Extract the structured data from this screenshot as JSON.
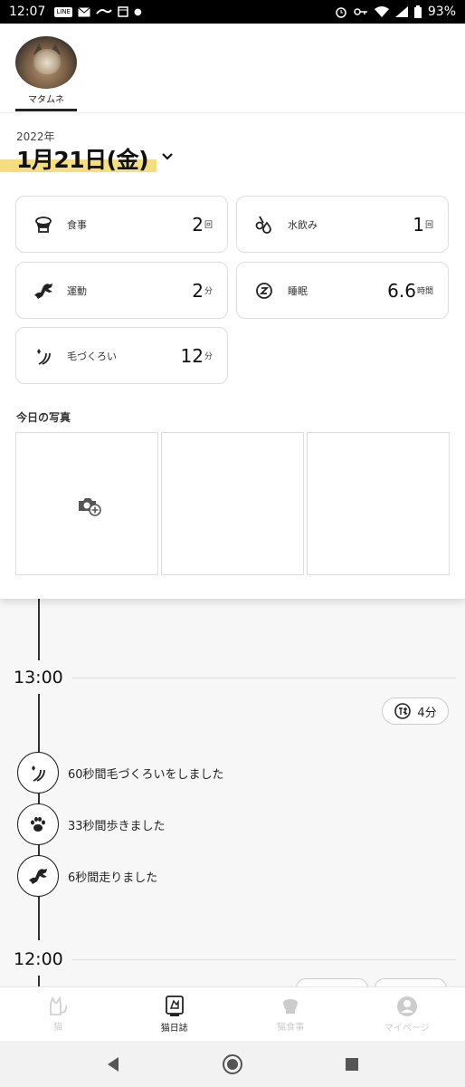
{
  "status_bar": {
    "time": "12:07",
    "left_icons": [
      "LINE",
      "mail-icon",
      "app-icon",
      "calendar-icon",
      "dot"
    ],
    "battery": "93%"
  },
  "cat": {
    "name": "マタムネ"
  },
  "date": {
    "year": "2022年",
    "label": "1月21日(金)"
  },
  "summary": [
    {
      "icon": "bowl-icon",
      "label": "食事",
      "value": "2",
      "unit": "回"
    },
    {
      "icon": "water-drop-icon",
      "label": "水飲み",
      "value": "1",
      "unit": "回"
    },
    {
      "icon": "running-cat-icon",
      "label": "運動",
      "value": "2",
      "unit": "分"
    },
    {
      "icon": "sleep-icon",
      "label": "睡眠",
      "value": "6.6",
      "unit": "時間"
    },
    {
      "icon": "grooming-icon",
      "label": "毛づくろい",
      "value": "12",
      "unit": "分"
    }
  ],
  "photos": {
    "title": "今日の写真"
  },
  "timeline": {
    "hour1": "13:00",
    "rest": {
      "icon": "rest-icon",
      "label": "4分"
    },
    "events": [
      {
        "icon": "grooming-icon",
        "text": "60秒間毛づくろいをしました"
      },
      {
        "icon": "paw-icon",
        "text": "33秒間歩きました"
      },
      {
        "icon": "running-cat-icon",
        "text": "6秒間走りました"
      }
    ],
    "hour2": "12:00"
  },
  "bottom_nav": [
    {
      "icon": "cat-icon",
      "label": "猫",
      "active": false
    },
    {
      "icon": "diary-icon",
      "label": "猫日誌",
      "active": true
    },
    {
      "icon": "food-icon",
      "label": "猫食事",
      "active": false
    },
    {
      "icon": "person-icon",
      "label": "マイページ",
      "active": false
    }
  ],
  "colors": {
    "highlight": "#f5dd82",
    "accent": "#222222",
    "background": "#f7f7f7"
  }
}
